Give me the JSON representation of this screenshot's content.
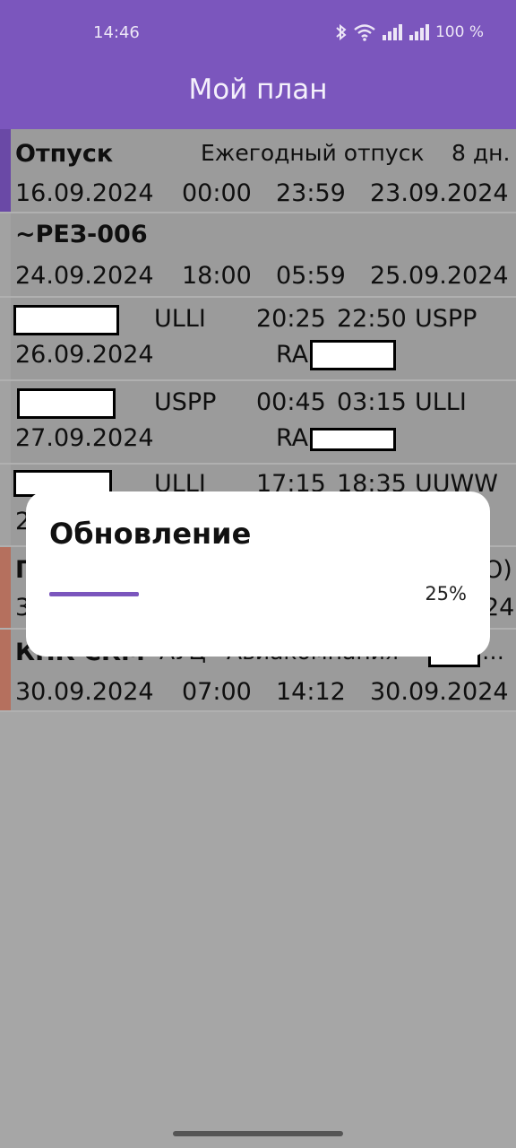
{
  "status": {
    "time": "14:46",
    "battery": "100 %",
    "icons": [
      "bluetooth-icon",
      "wifi-icon",
      "signal-icon",
      "signal-icon"
    ]
  },
  "appbar": {
    "title": "Мой план"
  },
  "rows": [
    {
      "accent": "#6a49a6",
      "line1": [
        "Отпуск",
        "Ежегодный отпуск",
        "8 дн."
      ],
      "line2": [
        "16.09.2024",
        "00:00",
        "23:59",
        "23.09.2024"
      ]
    },
    {
      "accent": "#a2a2a2",
      "line1": [
        "~РЕЗ-006"
      ],
      "line2": [
        "24.09.2024",
        "18:00",
        "05:59",
        "25.09.2024"
      ]
    },
    {
      "accent": "#a2a2a2",
      "line1": [
        "ULLI",
        "20:25",
        "22:50",
        "USPP"
      ],
      "line2": [
        "26.09.2024",
        "RA"
      ]
    },
    {
      "accent": "#a2a2a2",
      "line1": [
        "USPP",
        "00:45",
        "03:15",
        "ULLI"
      ],
      "line2": [
        "27.09.2024",
        "RA"
      ]
    },
    {
      "accent": "#a2a2a2",
      "line1": [
        "ULLI",
        "17:15",
        "18:35",
        "UUWW"
      ],
      "line2": [
        "2"
      ]
    },
    {
      "accent": "#b5705e",
      "line1": [
        "Г",
        "O)"
      ],
      "line2": [
        "3",
        "24"
      ]
    },
    {
      "accent": "#b5705e",
      "line1": [
        "КПК СКМ",
        "АУЦ",
        "Авиакомпания",
        "…"
      ],
      "line2": [
        "30.09.2024",
        "07:00",
        "14:12",
        "30.09.2024"
      ]
    }
  ],
  "dialog": {
    "title": "Обновление",
    "progress_label": "25%",
    "progress": 0.25
  }
}
